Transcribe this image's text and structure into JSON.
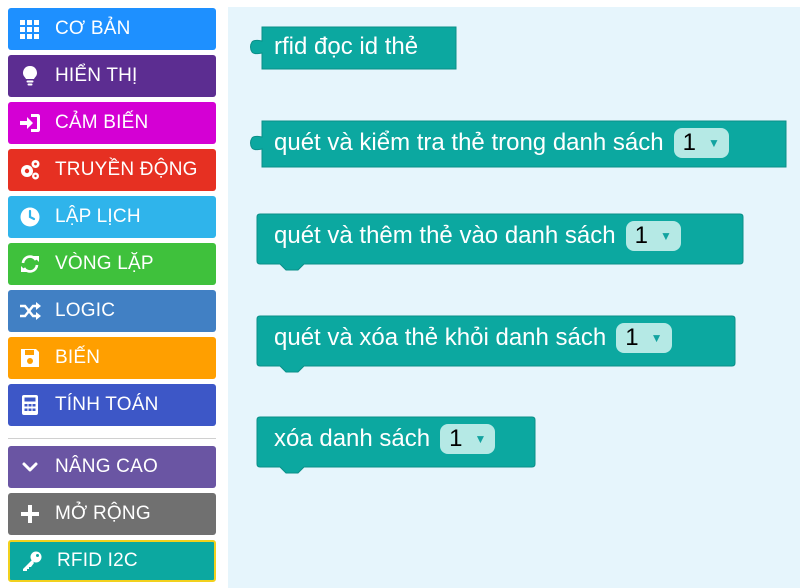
{
  "toolbox": {
    "categories": [
      {
        "label": "CƠ BẢN",
        "color": "#1e90ff",
        "icon": "grid-icon"
      },
      {
        "label": "HIỂN THỊ",
        "color": "#5c2d91",
        "icon": "lightbulb-icon"
      },
      {
        "label": "CẢM BIẾN",
        "color": "#d400d4",
        "icon": "sign-in-icon"
      },
      {
        "label": "TRUYỀN ĐỘNG",
        "color": "#e63022",
        "icon": "gears-icon"
      },
      {
        "label": "LẬP LỊCH",
        "color": "#2fb4eb",
        "icon": "clock-icon"
      },
      {
        "label": "VÒNG LẶP",
        "color": "#3fc13c",
        "icon": "refresh-icon"
      },
      {
        "label": "LOGIC",
        "color": "#4180c4",
        "icon": "shuffle-icon"
      },
      {
        "label": "BIẾN",
        "color": "#ff9f00",
        "icon": "save-icon"
      },
      {
        "label": "TÍNH TOÁN",
        "color": "#3d57c7",
        "icon": "calculator-icon"
      },
      {
        "label": "NÂNG CAO",
        "color": "#6a55a3",
        "icon": "chevron-down-icon"
      },
      {
        "label": "MỞ RỘNG",
        "color": "#707070",
        "icon": "plus-icon"
      },
      {
        "label": "RFID I2C",
        "color": "#0ca8a0",
        "icon": "key-icon"
      }
    ]
  },
  "blocks": {
    "color": "#0ca8a0",
    "items": [
      {
        "label": "rfid đọc id thẻ",
        "dropdown": null
      },
      {
        "label": "quét và kiểm tra thẻ trong danh sách",
        "dropdown": "1"
      },
      {
        "label": "quét và thêm thẻ vào danh sách",
        "dropdown": "1"
      },
      {
        "label": "quét và xóa thẻ khỏi danh sách",
        "dropdown": "1"
      },
      {
        "label": "xóa danh sách",
        "dropdown": "1"
      }
    ]
  }
}
